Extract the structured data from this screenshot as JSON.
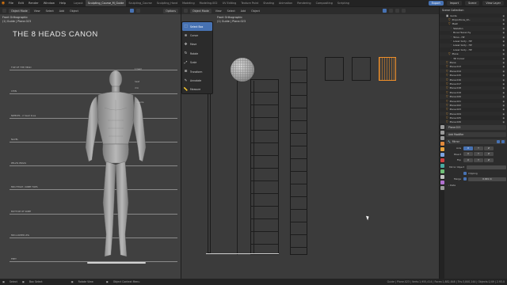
{
  "app": {
    "menus": [
      "File",
      "Edit",
      "Render",
      "Window",
      "Help"
    ],
    "tabs": [
      "Layout",
      "Sculpting_Course_M_Guide",
      "Sculpting_Course",
      "Sculpting_Hand",
      "Modeling",
      "Modeling.002",
      "UV Editing",
      "Texture Paint",
      "Shading",
      "Animation",
      "Rendering",
      "Compositing",
      "Scripting"
    ],
    "active_tab_index": 1,
    "scene_label": "Scene",
    "view_layer_label": "View Layer",
    "export_label": "Export",
    "import_label": "Import"
  },
  "left_editor": {
    "mode": "Object Mode",
    "menus": [
      "View",
      "Select",
      "Add",
      "Object"
    ],
    "shading": "Options",
    "info_line1": "Front Orthographic",
    "info_line2": "(1) Guide | Plane.023",
    "canon_title": "THE 8 HEADS CANON",
    "head_lines": [
      {
        "label": "TOP OF THE HEAD"
      },
      {
        "label": "CHIN"
      },
      {
        "label": "NIPPLES - 2 head lines"
      },
      {
        "label": "NAVEL"
      },
      {
        "label": "PELVIS PEAKS"
      },
      {
        "label": "MID-THIGH / KNEE TOPS"
      },
      {
        "label": "BOTTOM OF KNEE"
      },
      {
        "label": "MID-LOWER LEG"
      },
      {
        "label": "FEET"
      }
    ]
  },
  "right_editor": {
    "mode": "Object Mode",
    "menus": [
      "View",
      "Select",
      "Add",
      "Object"
    ],
    "info_line1": "Front Orthographic",
    "info_line2": "(1) Guide | Plane.023",
    "tools": [
      {
        "label": "Select Box",
        "icon": "select-box-icon",
        "glyph": "⬚",
        "active": true
      },
      {
        "label": "Cursor",
        "icon": "cursor-icon",
        "glyph": "⊕",
        "active": false
      },
      {
        "label": "Move",
        "icon": "move-icon",
        "glyph": "✥",
        "active": false
      },
      {
        "label": "Rotate",
        "icon": "rotate-icon",
        "glyph": "↻",
        "active": false
      },
      {
        "label": "Scale",
        "icon": "scale-icon",
        "glyph": "⤢",
        "active": false
      },
      {
        "label": "Transform",
        "icon": "transform-icon",
        "glyph": "⊞",
        "active": false
      },
      {
        "label": "Annotate",
        "icon": "annotate-icon",
        "glyph": "✎",
        "active": false
      },
      {
        "label": "Measure",
        "icon": "measure-icon",
        "glyph": "📏",
        "active": false
      }
    ]
  },
  "outliner": {
    "title": "Scene Collection",
    "rows": [
      {
        "label": "Guide",
        "indent": 1,
        "kind": "collection"
      },
      {
        "label": "Proportions_Ch..",
        "indent": 2,
        "kind": "mesh"
      },
      {
        "label": "Mesh",
        "indent": 2,
        "kind": "mesh"
      },
      {
        "label": "Skeleton",
        "indent": 3,
        "kind": "item"
      },
      {
        "label": "Bone Hierarchy",
        "indent": 3,
        "kind": "item"
      },
      {
        "label": "Torso - HP",
        "indent": 3,
        "kind": "item"
      },
      {
        "label": "Lower body - HP",
        "indent": 3,
        "kind": "item"
      },
      {
        "label": "Lower body - HP",
        "indent": 3,
        "kind": "item"
      },
      {
        "label": "Lower body - HP",
        "indent": 3,
        "kind": "item"
      },
      {
        "label": "Plane",
        "indent": 2,
        "kind": "mesh"
      },
      {
        "label": "3D Cursor",
        "indent": 3,
        "kind": "item"
      },
      {
        "label": "Plane",
        "indent": 1,
        "kind": "mesh"
      },
      {
        "label": "Plane.013",
        "indent": 1,
        "kind": "mesh"
      },
      {
        "label": "Plane.014",
        "indent": 1,
        "kind": "mesh"
      },
      {
        "label": "Plane.015",
        "indent": 1,
        "kind": "mesh"
      },
      {
        "label": "Plane.016",
        "indent": 1,
        "kind": "mesh"
      },
      {
        "label": "Plane.017",
        "indent": 1,
        "kind": "mesh"
      },
      {
        "label": "Plane.018",
        "indent": 1,
        "kind": "mesh"
      },
      {
        "label": "Plane.019",
        "indent": 1,
        "kind": "mesh"
      },
      {
        "label": "Plane.020",
        "indent": 1,
        "kind": "mesh"
      },
      {
        "label": "Plane.021",
        "indent": 1,
        "kind": "mesh"
      },
      {
        "label": "Plane.022",
        "indent": 1,
        "kind": "mesh"
      },
      {
        "label": "Plane.023",
        "indent": 1,
        "kind": "mesh"
      },
      {
        "label": "Plane.024",
        "indent": 1,
        "kind": "mesh"
      },
      {
        "label": "Plane.025",
        "indent": 1,
        "kind": "mesh"
      },
      {
        "label": "Plane.026",
        "indent": 1,
        "kind": "mesh"
      }
    ]
  },
  "properties": {
    "object_name": "Plane.023",
    "add_modifier_label": "Add Modifier",
    "modifier_name": "Mirror",
    "axis_label": "Axis",
    "bisect_label": "Bisect",
    "flip_label": "Flip",
    "axes": [
      "X",
      "Y",
      "Z"
    ],
    "mirror_object_label": "Mirror Object",
    "clipping_label": "Clipping",
    "merge_label": "Merge",
    "merge_value": "0.001 m",
    "data_label": "Data"
  },
  "status": {
    "select_label": "Select",
    "box_select_label": "Box Select",
    "rotate_view_label": "Rotate View",
    "context_menu_label": "Object Context Menu",
    "stats": "Guide | Plane.023 | Verts:1,955,414 | Faces:1,882,848 | Tris:3,840,144 | Objects:1/49 | 2.93.0"
  },
  "colors": {
    "accent_blue": "#4772b3",
    "selection_orange": "#f0902a",
    "viewport_bg": "#404040"
  }
}
